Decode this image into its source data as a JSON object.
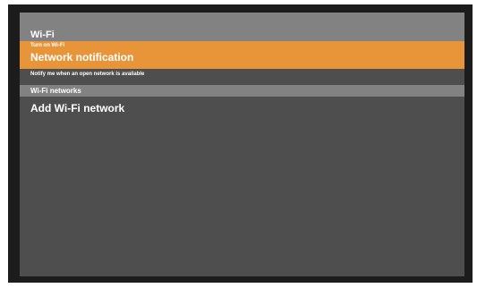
{
  "screen": {
    "title": "Wi-Fi",
    "toggle_label": "Turn on Wi-Fi",
    "notification_title": "Network notification",
    "notification_description": "Notify me when an open network is available",
    "networks_section_label": "Wi-Fi networks",
    "add_network_label": "Add Wi-Fi network"
  },
  "colors": {
    "highlight": "#e8953a",
    "header": "#828282",
    "background": "#4e4e4e",
    "bezel": "#1c1c1c"
  }
}
